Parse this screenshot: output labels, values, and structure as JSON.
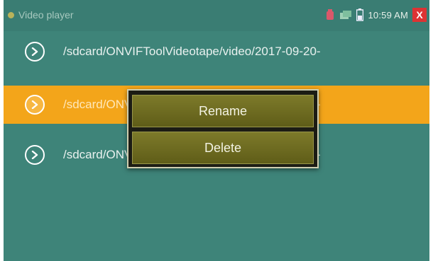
{
  "statusbar": {
    "app_title": "Video player",
    "time": "10:59 AM",
    "icons": [
      "app-indicator-icon",
      "record-icon",
      "network-icon",
      "battery-icon",
      "close-icon"
    ],
    "close_label": "X"
  },
  "files": [
    {
      "path": "/sdcard/ONVIFToolVideotape/video/2017-09-20-",
      "selected": false
    },
    {
      "path": "/sdcard/ONVIFToolVideotape/video/2017-09-20-",
      "selected": true
    },
    {
      "path": "/sdcard/ONVIFToolVideotape/video/2017-09-25-",
      "selected": false
    }
  ],
  "context_menu": {
    "rename_label": "Rename",
    "delete_label": "Delete"
  },
  "colors": {
    "background": "#3e8479",
    "selected_row": "#f3a51a",
    "menu_button": "#6e6b22",
    "close_button": "#dd3333"
  }
}
